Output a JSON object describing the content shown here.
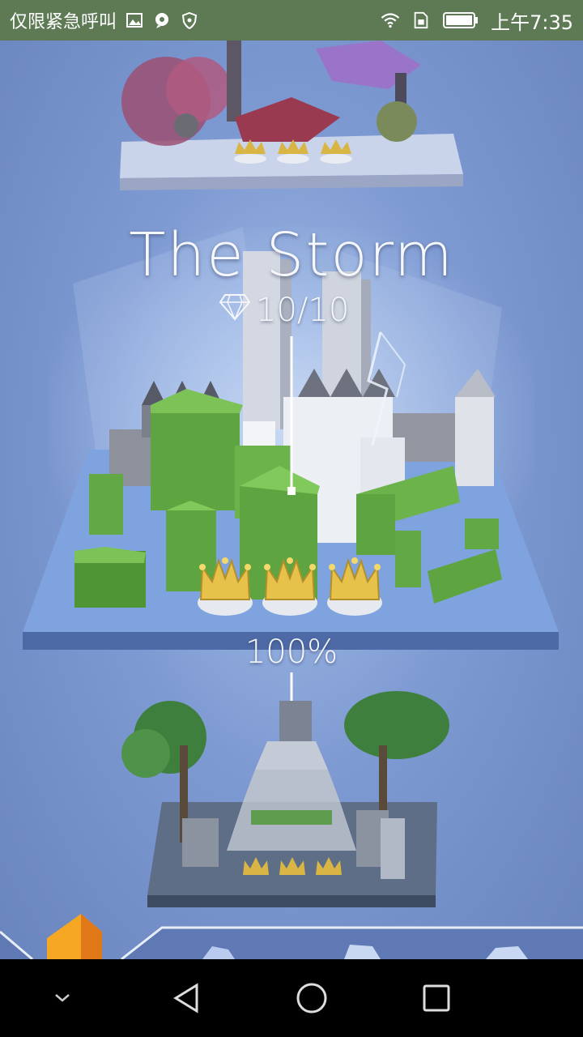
{
  "status_bar": {
    "carrier": "仅限紧急呼叫",
    "time": "上午7:35",
    "icons": [
      "gallery-icon",
      "chat-icon",
      "vpn-shield-icon",
      "wifi-icon",
      "sim-icon",
      "battery-icon"
    ]
  },
  "level": {
    "title": "The Storm",
    "gems": "10/10",
    "progress": "100%",
    "crowns": 3
  },
  "colors": {
    "sky": "#7e9ad2",
    "grass": "#6bb34a",
    "stone": "#dfe3ea",
    "crown": "#e7c24a",
    "status_bar": "#5d7a55"
  },
  "nav": {
    "buttons": [
      "back",
      "home",
      "recents"
    ]
  }
}
